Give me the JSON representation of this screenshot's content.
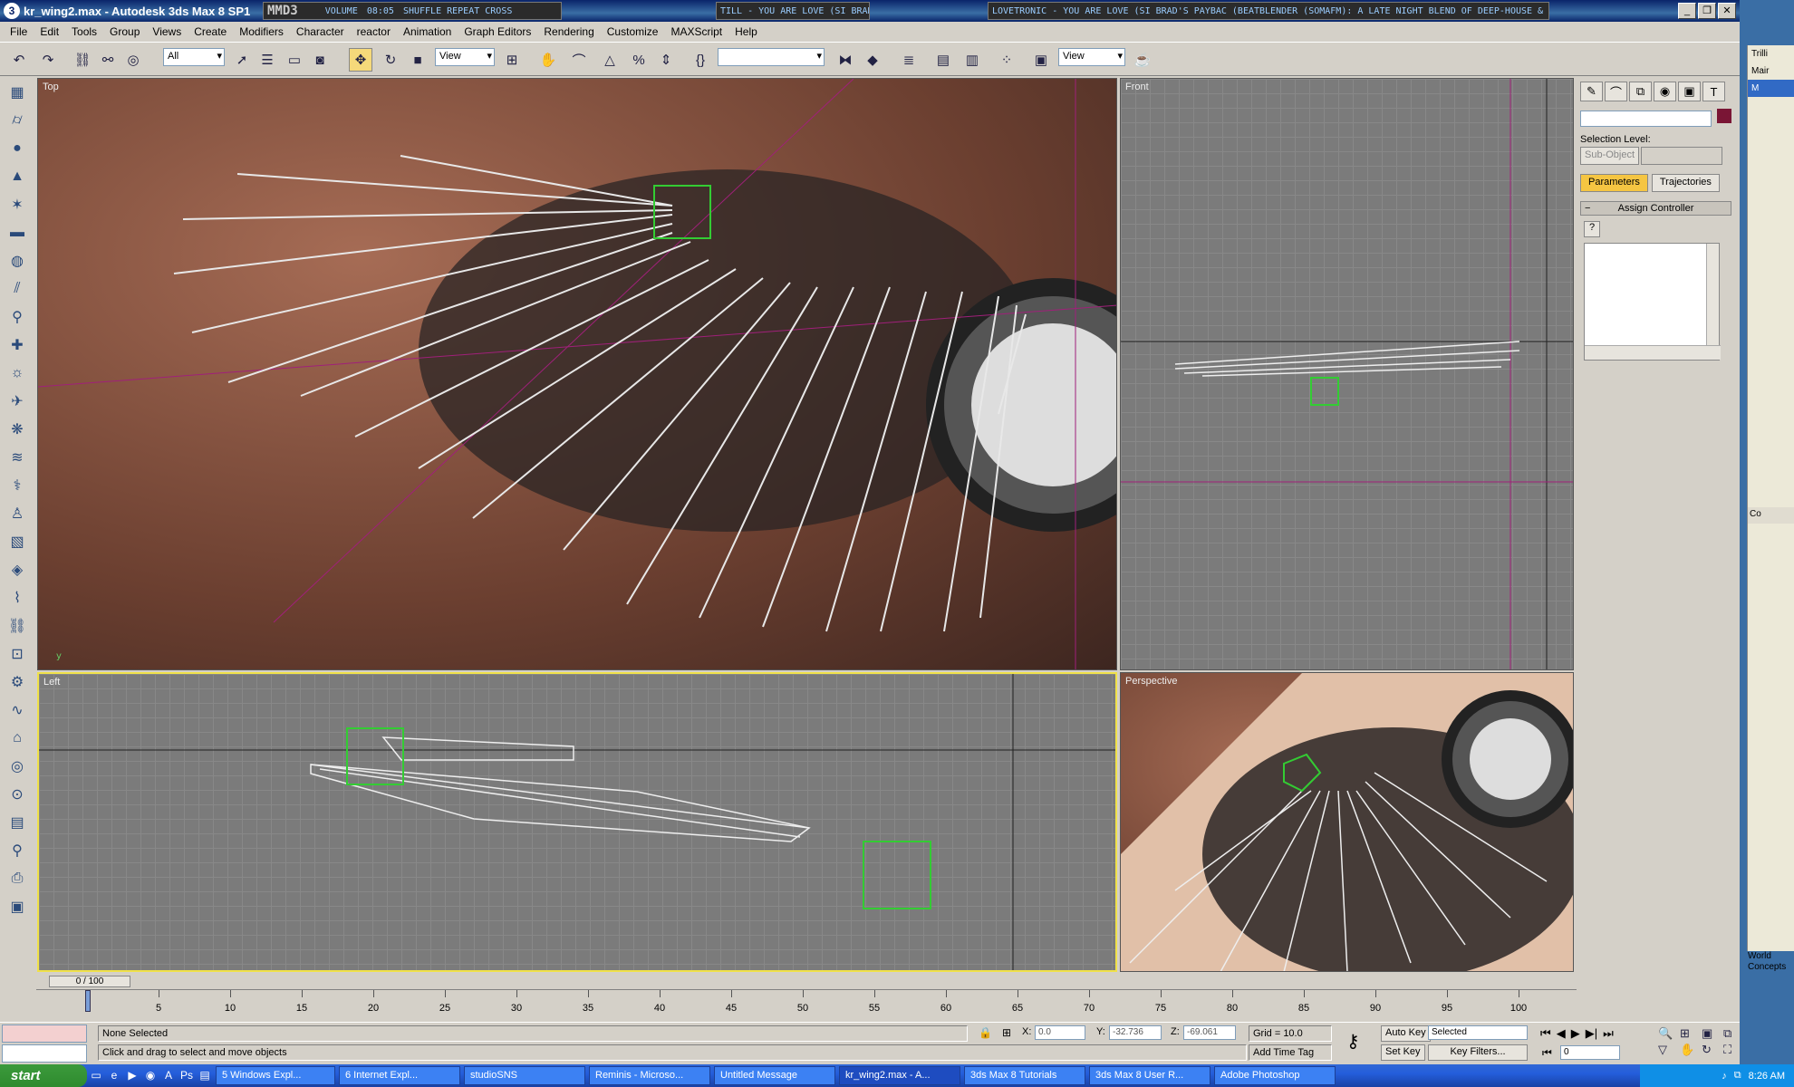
{
  "window": {
    "title": "kr_wing2.max - Autodesk 3ds Max 8 SP1",
    "app_icon": "3ds-max-icon"
  },
  "media_player": {
    "logo": "MMD3",
    "time": "08:05",
    "marquee1": "TILL - YOU ARE LOVE (SI BRAD'S PA...",
    "marquee2": "LOVETRONIC - YOU ARE LOVE (SI BRAD'S PAYBAC (BEATBLENDER (SOMAFM): A LATE NIGHT BLEND OF DEEP-HOUSE & DOWNTEMPO CHILL (SOMAFM))",
    "volume": "VOLUME",
    "shuffle": "SHUFFLE REPEAT CROSS"
  },
  "menu": [
    "File",
    "Edit",
    "Tools",
    "Group",
    "Views",
    "Create",
    "Modifiers",
    "Character",
    "reactor",
    "Animation",
    "Graph Editors",
    "Rendering",
    "Customize",
    "MAXScript",
    "Help"
  ],
  "toolbar": {
    "selection_filter": "All",
    "ref_coord": "View",
    "render_view": "View"
  },
  "viewports": {
    "top": "Top",
    "front": "Front",
    "left": "Left",
    "perspective": "Perspective"
  },
  "command_panel": {
    "selection_level_label": "Selection Level:",
    "sub_object": "Sub-Object",
    "tab_parameters": "Parameters",
    "tab_trajectories": "Trajectories",
    "rollout_title": "Assign Controller"
  },
  "timeline": {
    "frame": "0 / 100",
    "ticks": [
      "5",
      "10",
      "15",
      "20",
      "25",
      "30",
      "35",
      "40",
      "45",
      "50",
      "55",
      "60",
      "65",
      "70",
      "75",
      "80",
      "85",
      "90",
      "95",
      "100"
    ]
  },
  "status": {
    "selection": "None Selected",
    "prompt": "Click and drag to select and move objects",
    "x_label": "X:",
    "x_value": "0.0",
    "y_label": "Y:",
    "y_value": "-32.736",
    "z_label": "Z:",
    "z_value": "-69.061",
    "grid": "Grid = 10.0",
    "add_time_tag": "Add Time Tag",
    "auto_key": "Auto Key",
    "set_key": "Set Key",
    "selected": "Selected",
    "key_filters": "Key Filters...",
    "current_frame": "0"
  },
  "taskbar": {
    "start": "start",
    "tasks": [
      "5 Windows Expl...",
      "6 Internet Expl...",
      "studioSNS",
      "Reminis - Microso...",
      "Untitled Message",
      "kr_wing2.max - A...",
      "3ds Max 8 Tutorials",
      "3ds Max 8 User R...",
      "Adobe Photoshop"
    ],
    "clock": "8:26 AM"
  },
  "side_window": {
    "lines": [
      "Trilli",
      "Mair",
      "M"
    ],
    "co": "Co",
    "world": "World",
    "concepts": "Concepts"
  }
}
